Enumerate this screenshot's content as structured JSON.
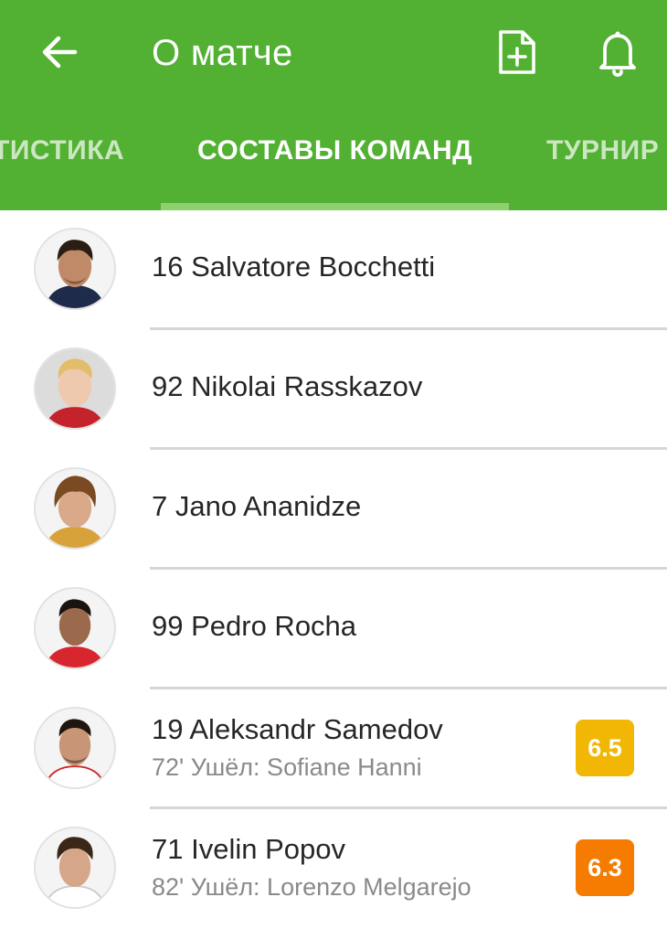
{
  "header": {
    "title": "О матче",
    "icons": [
      "back-arrow-icon",
      "add-document-icon",
      "bell-icon"
    ]
  },
  "tabs": [
    {
      "label": "ТИСТИКА",
      "active": false
    },
    {
      "label": "СОСТАВЫ КОМАНД",
      "active": true
    },
    {
      "label": "ТУРНИР",
      "active": false
    }
  ],
  "players": [
    {
      "label": "16 Salvatore Bocchetti",
      "sub": "",
      "rating": ""
    },
    {
      "label": "92 Nikolai Rasskazov",
      "sub": "",
      "rating": ""
    },
    {
      "label": "7 Jano Ananidze",
      "sub": "",
      "rating": ""
    },
    {
      "label": "99 Pedro Rocha",
      "sub": "",
      "rating": ""
    },
    {
      "label": "19 Aleksandr Samedov",
      "sub": "72' Ушёл: Sofiane Hanni",
      "rating": "6.5",
      "rating_color": "#f2b705"
    },
    {
      "label": "71 Ivelin Popov",
      "sub": "82' Ушёл: Lorenzo Melgarejo",
      "rating": "6.3",
      "rating_color": "#f57c00"
    }
  ],
  "colors": {
    "appbar": "#52b032",
    "tab_indicator": "#8ed06f",
    "divider": "#d6d6d6"
  }
}
